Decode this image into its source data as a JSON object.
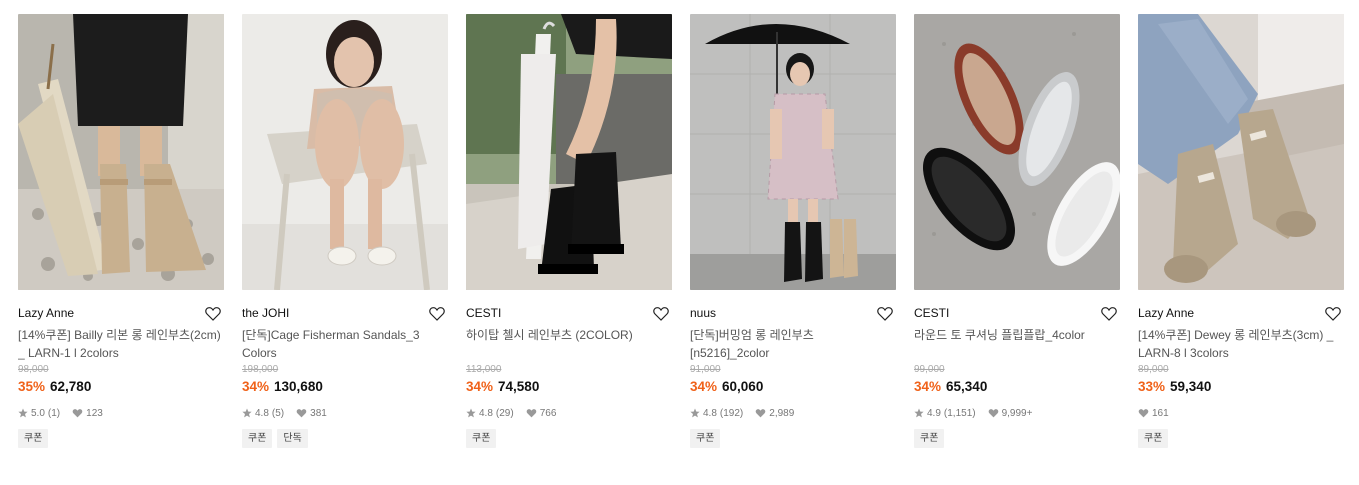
{
  "products": [
    {
      "brand": "Lazy Anne",
      "title": "[14%쿠폰] Bailly 리본 롱 레인부츠(2cm) _ LARN-1 l 2colors",
      "original_price": "98,000",
      "discount": "35%",
      "price": "62,780",
      "rating": "5.0",
      "review_count": "(1)",
      "likes": "123",
      "tags": [
        "쿠폰"
      ],
      "image": "umbrella-beige-rain-boots"
    },
    {
      "brand": "the JOHI",
      "title": "[단독]Cage Fisherman Sandals_3 Colors",
      "original_price": "198,000",
      "discount": "34%",
      "price": "130,680",
      "rating": "4.8",
      "review_count": "(5)",
      "likes": "381",
      "tags": [
        "쿠폰",
        "단독"
      ],
      "image": "woman-on-chair-white-sandals"
    },
    {
      "brand": "CESTI",
      "title": "하이탑 첼시 레인부츠 (2COLOR)",
      "original_price": "113,000",
      "discount": "34%",
      "price": "74,580",
      "rating": "4.8",
      "review_count": "(29)",
      "likes": "766",
      "tags": [
        "쿠폰"
      ],
      "image": "black-chelsea-boots-white-umbrella"
    },
    {
      "brand": "nuus",
      "title": "[단독]버밍엄 롱 레인부츠 [n5216]_2color",
      "original_price": "91,000",
      "discount": "34%",
      "price": "60,060",
      "rating": "4.8",
      "review_count": "(192)",
      "likes": "2,989",
      "tags": [
        "쿠폰"
      ],
      "image": "girl-black-umbrella-plaid-dress"
    },
    {
      "brand": "CESTI",
      "title": "라운드 토 쿠셔닝 플립플랍_4color",
      "original_price": "99,000",
      "discount": "34%",
      "price": "65,340",
      "rating": "4.9",
      "review_count": "(1,151)",
      "likes": "9,999+",
      "tags": [
        "쿠폰"
      ],
      "image": "flip-flop-sandals-four-colors"
    },
    {
      "brand": "Lazy Anne",
      "title": "[14%쿠폰] Dewey 롱 레인부츠(3cm) _ LARN-8 l 3colors",
      "original_price": "89,000",
      "discount": "33%",
      "price": "59,340",
      "rating": "",
      "review_count": "",
      "likes": "161",
      "tags": [
        "쿠폰"
      ],
      "image": "jeans-beige-rain-boots-steps"
    }
  ],
  "colors": {
    "discount": "#f0621a",
    "muted": "#777777",
    "tag_bg": "#f1f1f1"
  }
}
